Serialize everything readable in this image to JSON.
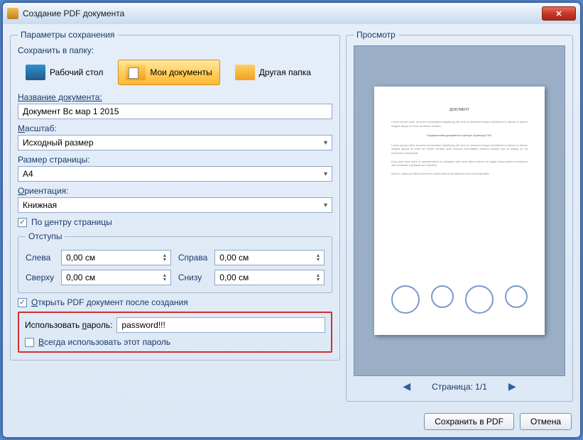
{
  "window": {
    "title": "Создание PDF документа"
  },
  "params": {
    "legend": "Параметры сохранения",
    "save_to_label": "Сохранить в папку:",
    "folders": {
      "desktop": "Рабочий стол",
      "mydocs": "Мои документы",
      "other": "Другая папка"
    },
    "docname_label": "Название документа:",
    "docname_value": "Документ Вс мар 1 2015",
    "scale_label": "Масштаб:",
    "scale_value": "Исходный размер",
    "pagesize_label": "Размер страницы:",
    "pagesize_value": "A4",
    "orient_label": "Ориентация:",
    "orient_value": "Книжная",
    "center_label": "По центру страницы",
    "margins": {
      "legend": "Отступы",
      "left_label": "Слева",
      "left_value": "0,00 см",
      "top_label": "Сверху",
      "top_value": "0,00 см",
      "right_label": "Справа",
      "right_value": "0,00 см",
      "bottom_label": "Снизу",
      "bottom_value": "0,00 см"
    },
    "open_after_label": "Открыть PDF документ после создания",
    "password": {
      "label": "Использовать пароль:",
      "value": "password!!!",
      "always_label": "Всегда использовать этот пароль"
    }
  },
  "preview": {
    "legend": "Просмотр",
    "page_label": "Страница: 1/1"
  },
  "footer": {
    "save": "Сохранить в PDF",
    "cancel": "Отмена"
  }
}
